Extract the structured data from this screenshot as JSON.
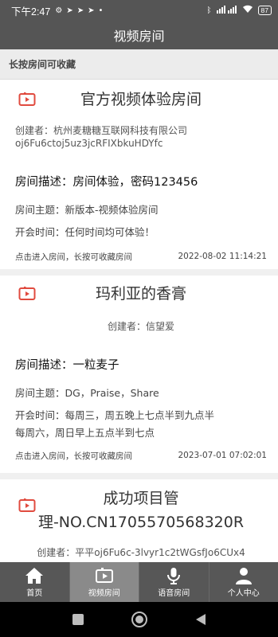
{
  "status": {
    "time": "下午2:47",
    "battery": "87",
    "notif_icons": [
      "gear-icon",
      "send-icon",
      "send-icon",
      "send-icon",
      "dot-icon"
    ]
  },
  "app_bar": {
    "title": "视频房间"
  },
  "hint": "长按房间可收藏",
  "rooms": [
    {
      "title": "官方视频体验房间",
      "creator_lines": [
        "创建者：杭州麦糖糖互联网科技有限公司",
        "oj6Fu6ctoj5uz3jcRFIXbkuHDYfc"
      ],
      "description": "房间描述：房间体验，密码123456",
      "topic": "房间主题：新版本-视频体验房间",
      "meeting_time_lines": [
        "开会时间：任何时间均可体验！"
      ],
      "footer_hint": "点击进入房间，长按可收藏房间",
      "date": "2022-08-02 11:14:21"
    },
    {
      "title": "玛利亚的香膏",
      "creator_lines": [
        "创建者：信望爱"
      ],
      "description": "房间描述：一粒麦子",
      "topic": "房间主题：DG，Praise，Share",
      "meeting_time_lines": [
        "开会时间：每周三，周五晚上七点半到九点半",
        "每周六，周日早上五点半到七点"
      ],
      "footer_hint": "点击进入房间，长按可收藏房间",
      "date": "2023-07-01 07:02:01"
    },
    {
      "title_lines": [
        "成功项目管",
        "理-NO.CN1705570568320R"
      ],
      "creator_lines": [
        "创建者：平平oj6Fu6c-3lvyr1c2tWGsfJo6CUx4"
      ]
    }
  ],
  "tabs": [
    {
      "label": "首页",
      "icon": "home-icon"
    },
    {
      "label": "视频房间",
      "icon": "video-room-icon"
    },
    {
      "label": "语音房间",
      "icon": "microphone-icon"
    },
    {
      "label": "个人中心",
      "icon": "person-icon"
    }
  ],
  "colors": {
    "accent_red": "#e04b3f",
    "bar_gray": "#555555",
    "active_tab": "#8a8a8a"
  }
}
